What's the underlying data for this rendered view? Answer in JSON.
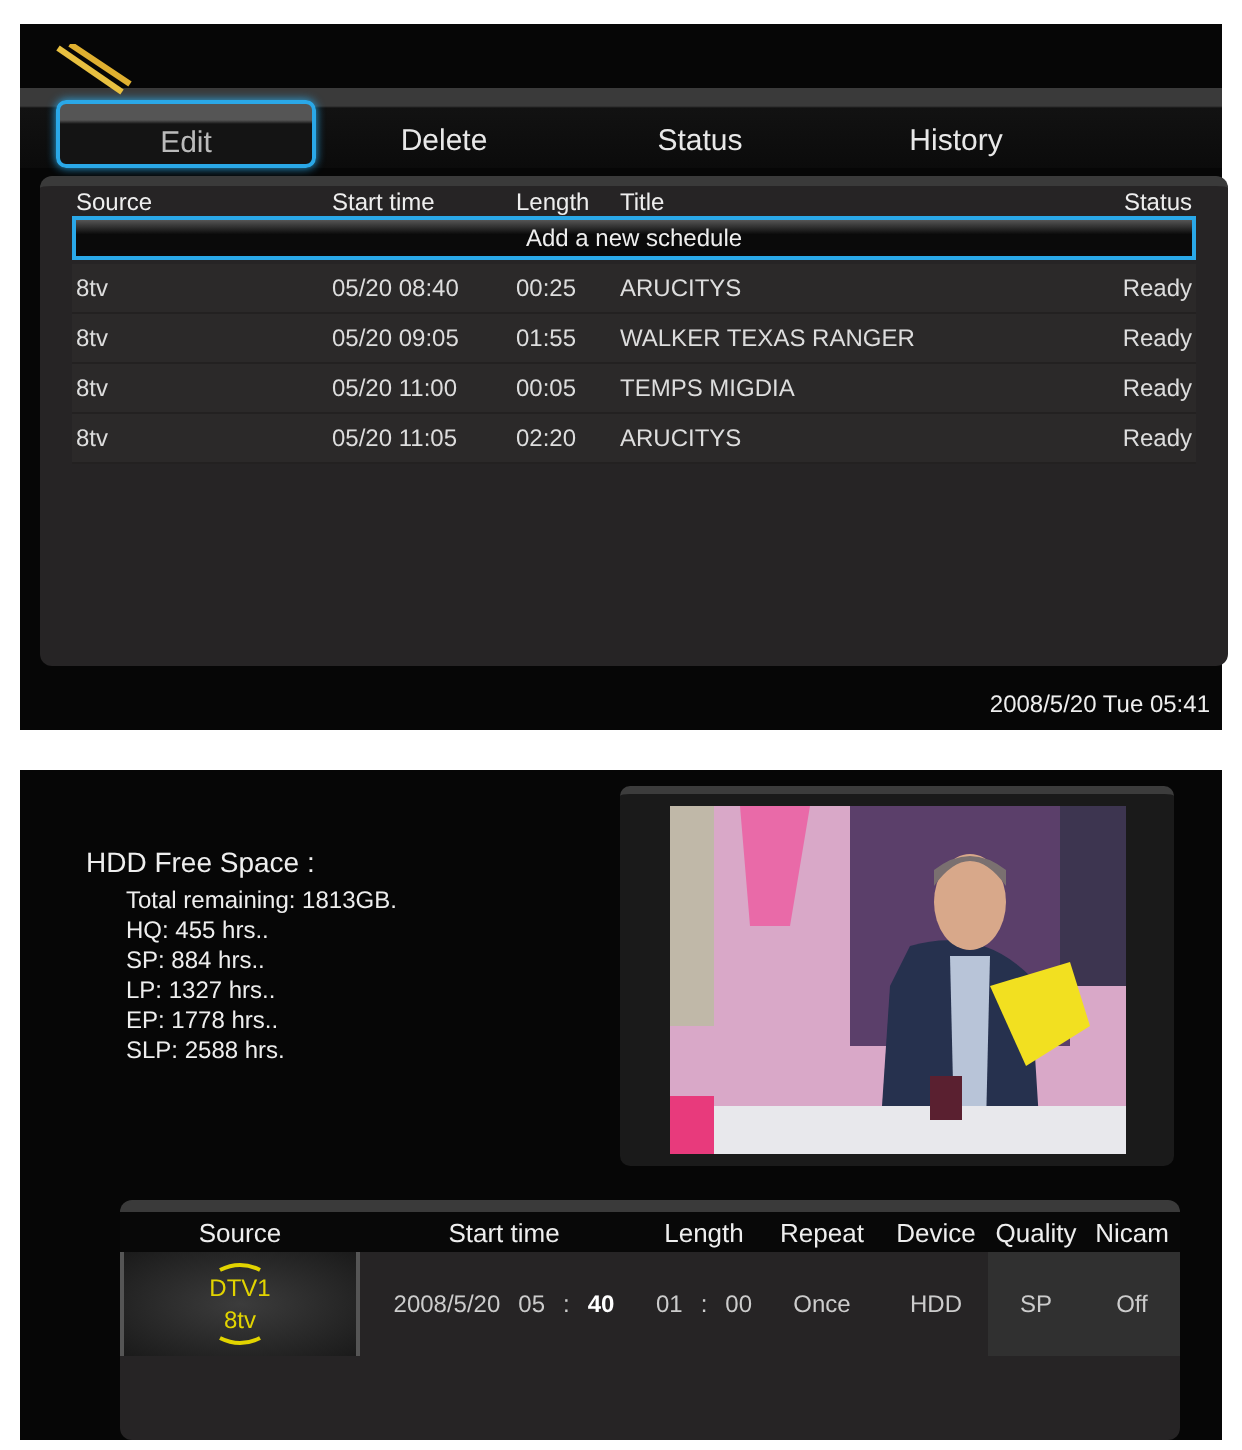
{
  "schedule_screen": {
    "tabs": [
      {
        "label": "Edit",
        "selected": true
      },
      {
        "label": "Delete",
        "selected": false
      },
      {
        "label": "Status",
        "selected": false
      },
      {
        "label": "History",
        "selected": false
      }
    ],
    "table": {
      "columns": [
        "Source",
        "Start time",
        "Length",
        "Title",
        "Status"
      ],
      "add_row": {
        "label": "Add a new schedule",
        "selected": true
      },
      "rows": [
        [
          "8tv",
          "05/20 08:40",
          "00:25",
          "ARUCITYS",
          "Ready"
        ],
        [
          "8tv",
          "05/20 09:05",
          "01:55",
          "WALKER TEXAS RANGER",
          "Ready"
        ],
        [
          "8tv",
          "05/20 11:00",
          "00:05",
          "TEMPS MIGDIA",
          "Ready"
        ],
        [
          "8tv",
          "05/20 11:05",
          "02:20",
          "ARUCITYS",
          "Ready"
        ]
      ]
    },
    "clock": "2008/5/20 Tue 05:41"
  },
  "record_screen": {
    "hdd": {
      "title": "HDD Free Space :",
      "lines": [
        "Total remaining: 1813GB.",
        "HQ: 455 hrs..",
        "SP: 884 hrs..",
        "LP: 1327 hrs..",
        "EP: 1778 hrs..",
        "SLP: 2588 hrs."
      ]
    },
    "form": {
      "columns": [
        "Source",
        "Start time",
        "Length",
        "Repeat",
        "Device",
        "Quality",
        "Nicam"
      ],
      "source": {
        "channel": "DTV1",
        "name": "8tv"
      },
      "start_time": [
        {
          "text": "2008/5/20",
          "focused": false
        },
        {
          "text": "05",
          "focused": false
        },
        {
          "text": ":",
          "focused": false
        },
        {
          "text": "40",
          "focused": true
        }
      ],
      "length": [
        {
          "text": "01",
          "focused": false
        },
        {
          "text": ":",
          "focused": false
        },
        {
          "text": "00",
          "focused": false
        }
      ],
      "repeat": "Once",
      "device": "HDD",
      "quality": "SP",
      "nicam": "Off"
    }
  }
}
